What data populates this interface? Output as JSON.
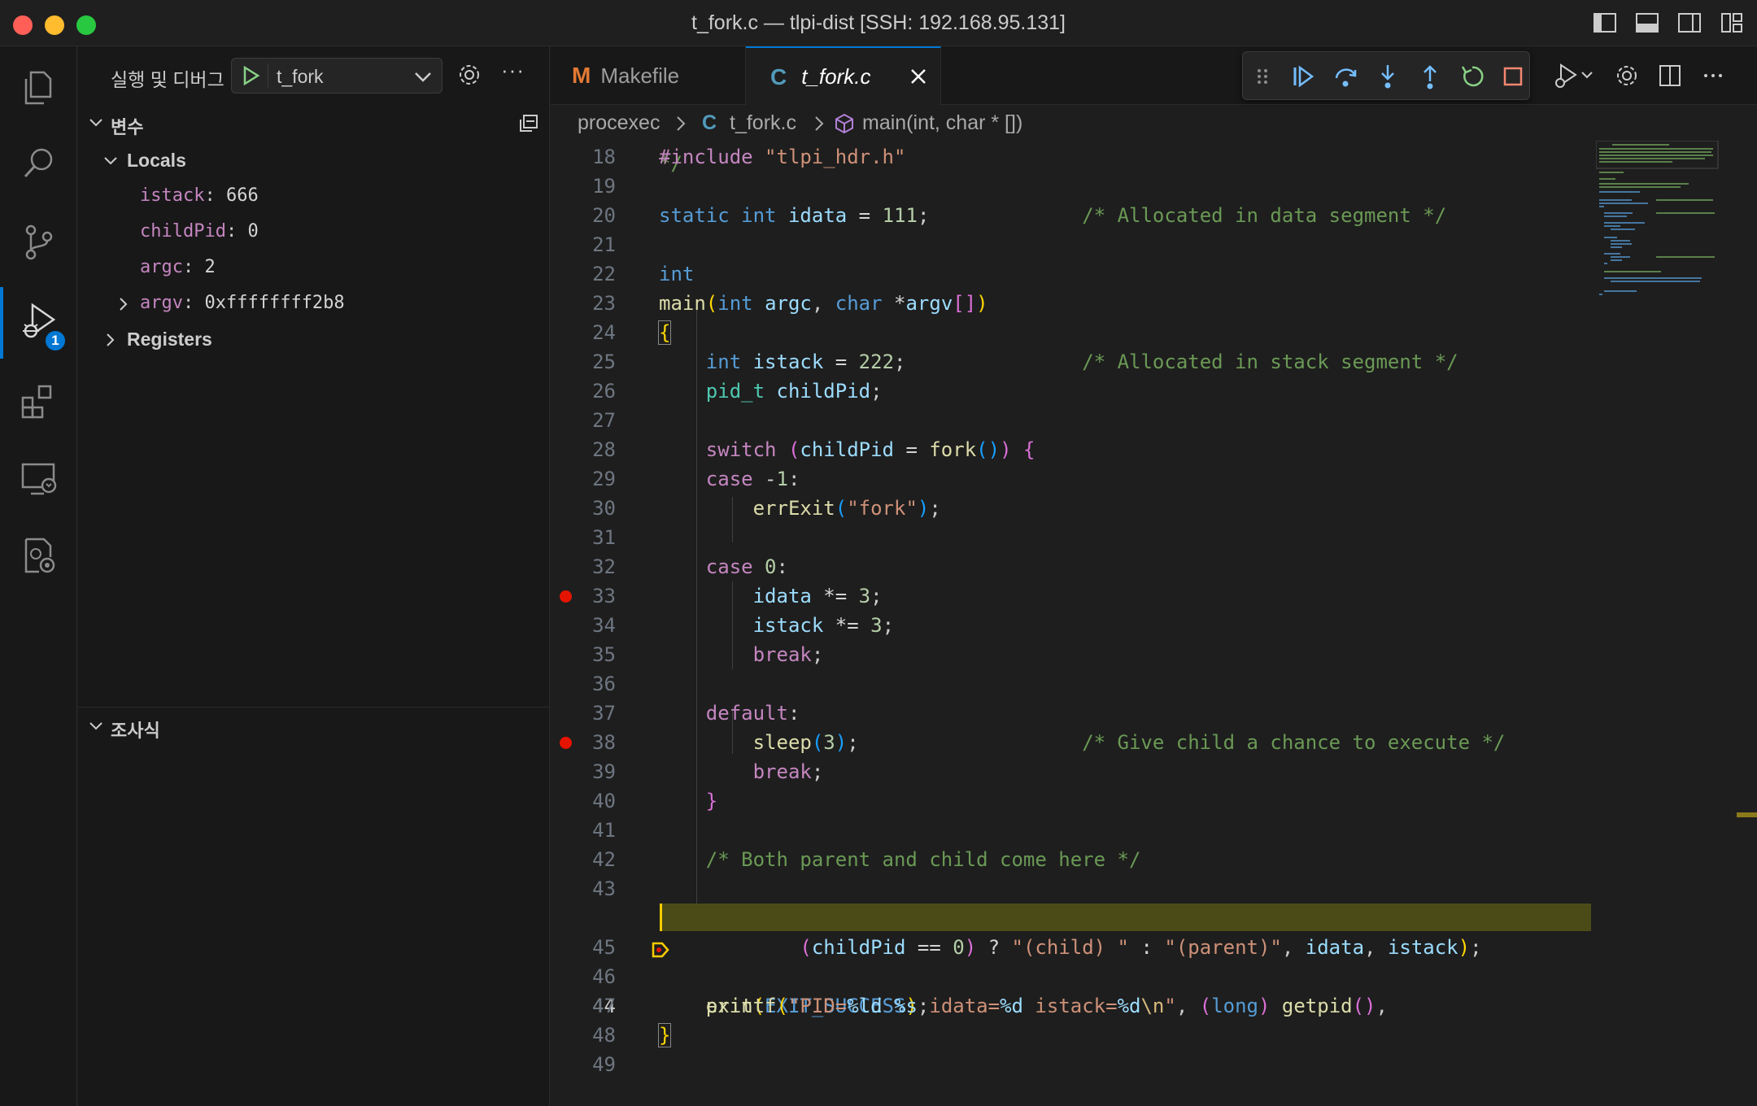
{
  "window": {
    "title": "t_fork.c — tlpi-dist [SSH: 192.168.95.131]"
  },
  "activity_bar": {
    "debug_badge": "1"
  },
  "sidebar": {
    "title": "실행 및 디버그",
    "launch_config": "t_fork",
    "variables_title": "변수",
    "locals_label": "Locals",
    "locals": [
      {
        "name": "istack",
        "value": "666"
      },
      {
        "name": "childPid",
        "value": "0"
      },
      {
        "name": "argc",
        "value": "2"
      },
      {
        "name": "argv",
        "value": "0xffffffff2b8"
      }
    ],
    "registers_label": "Registers",
    "watch_title": "조사식"
  },
  "tabs": [
    {
      "label": "Makefile",
      "icon": "M"
    },
    {
      "label": "t_fork.c",
      "icon": "C"
    }
  ],
  "breadcrumb": {
    "folder": "procexec",
    "file": "t_fork.c",
    "symbol": "main(int, char * [])"
  },
  "editor": {
    "current_line": 44,
    "breakpoints": [
      33,
      38
    ],
    "lines": [
      {
        "n": "18",
        "code": "#include \"tlpi_hdr.h\""
      },
      {
        "n": "19",
        "code": ""
      },
      {
        "n": "20",
        "code": "static int idata = 111;             /* Allocated in data segment */"
      },
      {
        "n": "21",
        "code": ""
      },
      {
        "n": "22",
        "code": "int"
      },
      {
        "n": "23",
        "code": "main(int argc, char *argv[])"
      },
      {
        "n": "24",
        "code": "{"
      },
      {
        "n": "25",
        "code": "    int istack = 222;               /* Allocated in stack segment */"
      },
      {
        "n": "26",
        "code": "    pid_t childPid;"
      },
      {
        "n": "27",
        "code": ""
      },
      {
        "n": "28",
        "code": "    switch (childPid = fork()) {"
      },
      {
        "n": "29",
        "code": "    case -1:"
      },
      {
        "n": "30",
        "code": "        errExit(\"fork\");"
      },
      {
        "n": "31",
        "code": ""
      },
      {
        "n": "32",
        "code": "    case 0:"
      },
      {
        "n": "33",
        "code": "        idata *= 3;"
      },
      {
        "n": "34",
        "code": "        istack *= 3;"
      },
      {
        "n": "35",
        "code": "        break;"
      },
      {
        "n": "36",
        "code": ""
      },
      {
        "n": "37",
        "code": "    default:"
      },
      {
        "n": "38",
        "code": "        sleep(3);                   /* Give child a chance to execute */"
      },
      {
        "n": "39",
        "code": "        break;"
      },
      {
        "n": "40",
        "code": "    }"
      },
      {
        "n": "41",
        "code": ""
      },
      {
        "n": "42",
        "code": "    /* Both parent and child come here */"
      },
      {
        "n": "43",
        "code": ""
      },
      {
        "n": "44",
        "code": "    printf(\"PID=%ld %s idata=%d istack=%d\\n\", (long) getpid(),"
      },
      {
        "n": "45",
        "code": "            (childPid == 0) ? \"(child) \" : \"(parent)\", idata, istack);"
      },
      {
        "n": "46",
        "code": ""
      },
      {
        "n": "47",
        "code": "    exit(EXIT_SUCCESS);"
      },
      {
        "n": "48",
        "code": "}"
      },
      {
        "n": "49",
        "code": ""
      }
    ]
  },
  "icons": {
    "activity": [
      "explorer-icon",
      "search-icon",
      "source-control-icon",
      "run-debug-icon",
      "extensions-icon",
      "remote-explorer-icon",
      "testing-icon"
    ],
    "debug_toolbar": [
      "drag-handle-icon",
      "continue-icon",
      "step-over-icon",
      "step-into-icon",
      "step-out-icon",
      "restart-icon",
      "stop-icon"
    ]
  },
  "colors": {
    "accent": "#0078d4",
    "breakpoint": "#e51400",
    "current_line_bg": "#4b4b18"
  }
}
